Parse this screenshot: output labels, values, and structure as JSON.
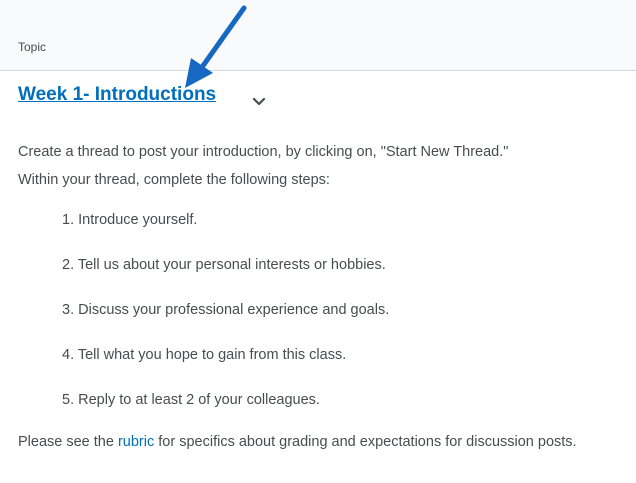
{
  "header": {
    "label": "Topic"
  },
  "topic": {
    "title": "Week 1- Introductions",
    "expand_icon": "chevron-down-icon"
  },
  "annotation": {
    "icon": "arrow-icon",
    "color": "#1668c2"
  },
  "intro": {
    "line1": "Create a thread to post your introduction, by clicking on, \"Start New Thread.\"",
    "line2": "Within your thread, complete the following steps:"
  },
  "steps": [
    "1.  Introduce yourself.",
    "2.  Tell us about your personal interests or hobbies.",
    "3.  Discuss your professional experience and goals.",
    "4.  Tell what you hope to gain from this class.",
    "5.  Reply to at least 2 of your colleagues."
  ],
  "footer": {
    "before_link": "Please see the ",
    "link_text": "rubric",
    "after_link": " for specifics about grading and expectations for discussion posts."
  },
  "colors": {
    "link": "#006fbf",
    "text": "#494c4e",
    "header_bg": "#f9fafb"
  }
}
